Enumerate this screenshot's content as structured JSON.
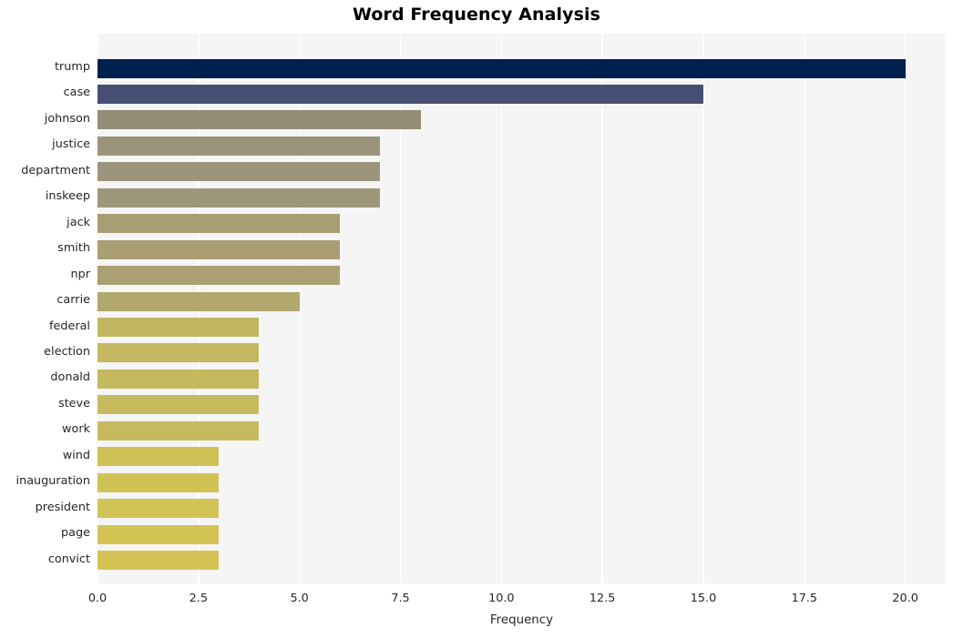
{
  "chart_data": {
    "type": "bar",
    "orientation": "horizontal",
    "title": "Word Frequency Analysis",
    "xlabel": "Frequency",
    "ylabel": "",
    "xlim": [
      0,
      21.0
    ],
    "xticks": [
      "0.0",
      "2.5",
      "5.0",
      "7.5",
      "10.0",
      "12.5",
      "15.0",
      "17.5",
      "20.0"
    ],
    "xtick_values": [
      0.0,
      2.5,
      5.0,
      7.5,
      10.0,
      12.5,
      15.0,
      17.5,
      20.0
    ],
    "grid": "vertical-white-on-lightgray",
    "legend": "none",
    "categories": [
      "trump",
      "case",
      "johnson",
      "justice",
      "department",
      "inskeep",
      "jack",
      "smith",
      "npr",
      "carrie",
      "federal",
      "election",
      "donald",
      "steve",
      "work",
      "wind",
      "inauguration",
      "president",
      "page",
      "convict"
    ],
    "values": [
      20,
      15,
      8,
      7,
      7,
      7,
      6,
      6,
      6,
      5,
      4,
      4,
      4,
      4,
      4,
      3,
      3,
      3,
      3,
      3
    ],
    "bar_colors": [
      "#002050",
      "#464f73",
      "#938d77",
      "#9c947a",
      "#9d957b",
      "#9e9779",
      "#a89e73",
      "#a99f73",
      "#aaa073",
      "#b2a76d",
      "#c2b561",
      "#c4b760",
      "#c5b85f",
      "#c6b95e",
      "#c7ba5e",
      "#d0c157",
      "#d1c256",
      "#d2c356",
      "#d3c455",
      "#d4c255"
    ],
    "plot_background": "#f5f5f5",
    "gridline_color": "#ffffff",
    "figure_background": "#ffffff"
  }
}
